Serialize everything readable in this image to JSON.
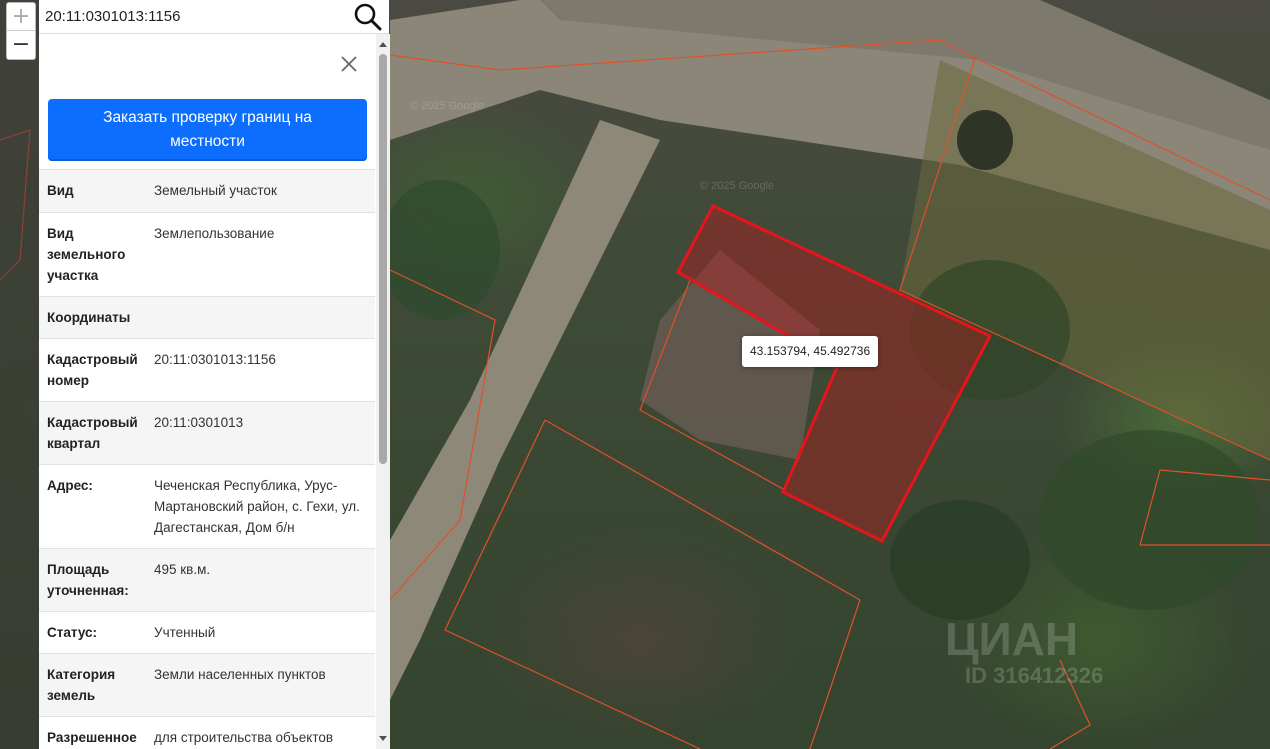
{
  "search": {
    "value": "20:11:0301013:1156"
  },
  "zoom": {
    "in_label": "+",
    "out_label": "−"
  },
  "panel": {
    "order_button_label": "Заказать проверку границ на местности",
    "rows": [
      {
        "key": "Вид",
        "value": "Земельный участок"
      },
      {
        "key": "Вид земельного участка",
        "value": "Землепользование"
      },
      {
        "key": "Координаты",
        "value": ""
      },
      {
        "key": "Кадастровый номер",
        "value": "20:11:0301013:1156"
      },
      {
        "key": "Кадастровый квартал",
        "value": "20:11:0301013"
      },
      {
        "key": "Адрес:",
        "value": "Чеченская Республика, Урус-Мартановский район, с. Гехи, ул. Дагестанская, Дом б/н"
      },
      {
        "key": "Площадь уточненная:",
        "value": "495 кв.м."
      },
      {
        "key": "Статус:",
        "value": "Учтенный"
      },
      {
        "key": "Категория земель",
        "value": "Земли населенных пунктов"
      },
      {
        "key": "Разрешенное",
        "value": "для строительства объектов"
      }
    ]
  },
  "map": {
    "coordinate_tooltip": "43.153794, 45.492736",
    "watermarks": [
      "© 2025 Google",
      "© 2025 Google",
      "ЦИАН",
      "ID 316412326"
    ],
    "selected_parcel_color": "#e8141b",
    "parcel_border_color": "#e0502a"
  },
  "colors": {
    "button": "#0d6efd"
  }
}
